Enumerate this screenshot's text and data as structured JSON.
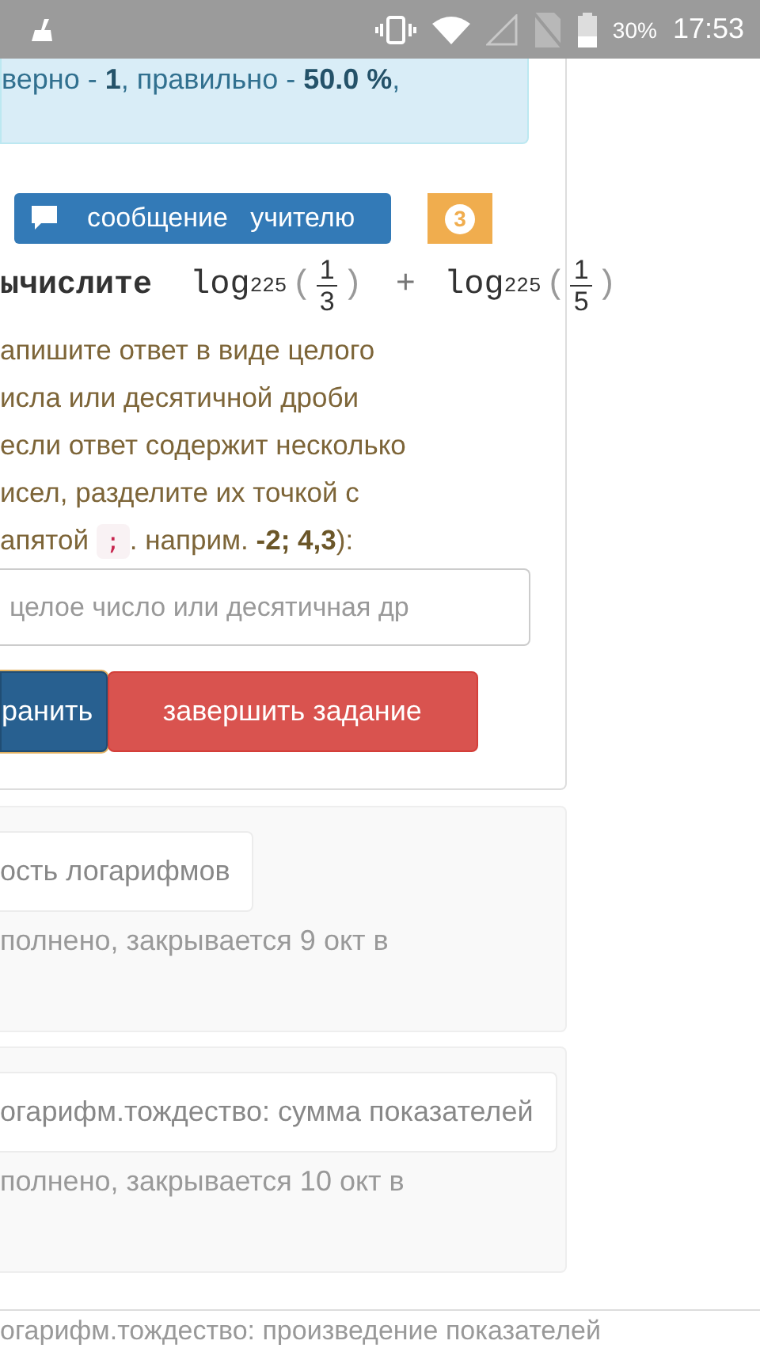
{
  "status_bar": {
    "battery": "30%",
    "time": "17:53"
  },
  "result_alert": {
    "text": "верно - **1**, правильно - **50.0 %**,"
  },
  "message_button": {
    "label": "сообщение   учителю"
  },
  "counter_badge": {
    "count": "3"
  },
  "task": {
    "verb": "ычислите",
    "terms": [
      {
        "fn": "log",
        "base": "225",
        "open": "(",
        "num": "1",
        "den": "3",
        "close": ")"
      },
      {
        "fn": "log",
        "base": "225",
        "open": "(",
        "num": "1",
        "den": "5",
        "close": ")"
      }
    ],
    "operator": "+"
  },
  "instruction": {
    "lines": [
      "апишите ответ в виде целого",
      "исла или десятичной дроби",
      "если ответ содержит несколько",
      "исел, разделите их точкой с"
    ],
    "last_line_before": "апятой",
    "separator": ";",
    "last_line_after": ". наприм. **-2; 4,3**):"
  },
  "answer_field": {
    "placeholder": "целое число или десятичная др"
  },
  "buttons": [
    {
      "label": "ранить",
      "kind": "save",
      "focused": true
    },
    {
      "label": "завершить задание",
      "kind": "finish",
      "focused": false
    }
  ],
  "assignments": [
    {
      "title": "ость логарифмов",
      "status": "полнено, закрывается 9 окт в"
    },
    {
      "title": "огарифм.тождество: сумма показателей",
      "status": "полнено, закрывается 10 окт в"
    }
  ],
  "bottom_bar": {
    "text": "огарифм.тождество: произведение показателей"
  }
}
